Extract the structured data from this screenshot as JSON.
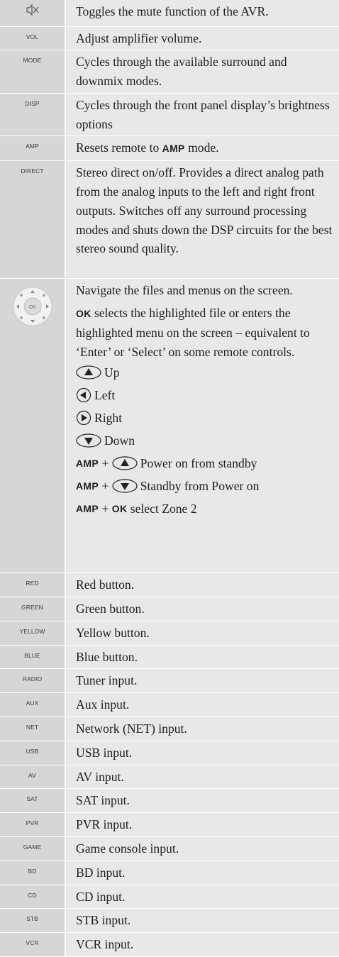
{
  "rows": [
    {
      "key": "",
      "icon": "mute-icon",
      "desc": "Toggles the mute function of the AVR."
    },
    {
      "key": "VOL",
      "desc": "Adjust amplifier volume."
    },
    {
      "key": "MODE",
      "desc": "Cycles through the available surround and downmix modes."
    },
    {
      "key": "DISP",
      "desc": "Cycles through the front panel display’s brightness options"
    },
    {
      "key": "AMP",
      "desc_prefix": "Resets remote to ",
      "desc_bold": "AMP",
      "desc_suffix": " mode."
    },
    {
      "key": "DIRECT",
      "desc": "Stereo direct on/off. Provides a direct analog path from the analog inputs to the left and right front outputs. Switches off any surround processing modes and shuts down the DSP circuits for the best stereo sound quality."
    },
    {
      "key": "",
      "icon": "navigation-pad-icon",
      "pad_center_label": "OK",
      "nav_intro": "Navigate the files and menus on the screen.",
      "ok_bold": "OK",
      "ok_text": " selects the highlighted file or enters the highlighted menu on the screen – equivalent to ‘Enter’ or ‘Select’ on some remote controls.",
      "up": "Up",
      "left": "Left",
      "right": "Right",
      "down": "Down",
      "amp_bold": "AMP",
      "plus": " + ",
      "amp_up_text": "Power on from standby",
      "amp_down_text": "Standby from Power on",
      "amp_ok_text": "select Zone 2"
    },
    {
      "key": "RED",
      "desc": "Red button."
    },
    {
      "key": "GREEN",
      "desc": "Green button."
    },
    {
      "key": "YELLOW",
      "desc": "Yellow button."
    },
    {
      "key": "BLUE",
      "desc": "Blue button."
    },
    {
      "key": "RADIO",
      "desc": "Tuner input."
    },
    {
      "key": "AUX",
      "desc": "Aux input."
    },
    {
      "key": "NET",
      "desc": "Network (NET) input."
    },
    {
      "key": "USB",
      "desc": "USB input."
    },
    {
      "key": "AV",
      "desc": "AV input."
    },
    {
      "key": "SAT",
      "desc": "SAT input."
    },
    {
      "key": "PVR",
      "desc": "PVR input."
    },
    {
      "key": "GAME",
      "desc": "Game console input."
    },
    {
      "key": "BD",
      "desc": "BD input."
    },
    {
      "key": "CD",
      "desc": "CD input."
    },
    {
      "key": "STB",
      "desc": "STB input."
    },
    {
      "key": "VCR",
      "desc": "VCR input."
    }
  ]
}
